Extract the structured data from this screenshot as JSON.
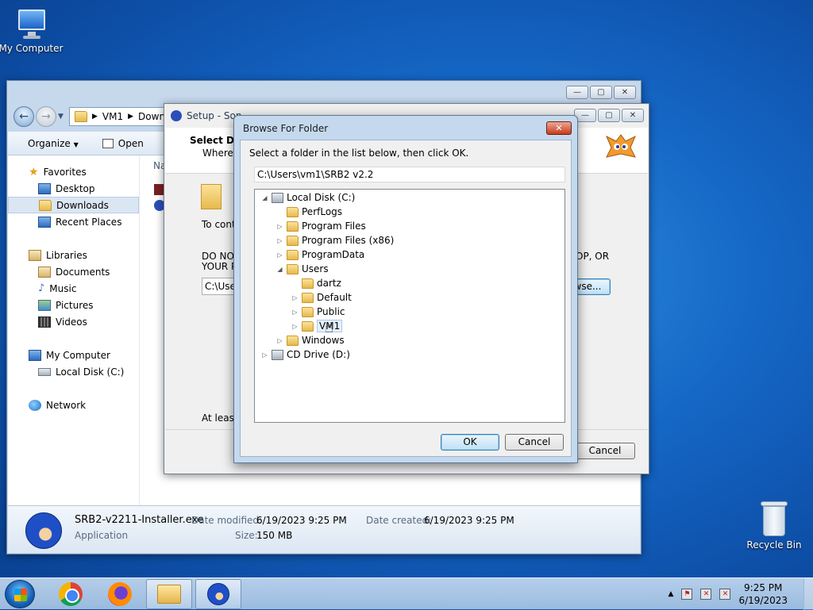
{
  "desktop": {
    "my_computer": "My Computer",
    "recycle_bin": "Recycle Bin"
  },
  "explorer": {
    "breadcrumb": [
      "VM1",
      "Down"
    ],
    "toolbar": {
      "organize": "Organize",
      "open": "Open"
    },
    "column_header": "Na",
    "nav": {
      "favorites": "Favorites",
      "desktop": "Desktop",
      "downloads": "Downloads",
      "recent": "Recent Places",
      "libraries": "Libraries",
      "documents": "Documents",
      "music": "Music",
      "pictures": "Pictures",
      "videos": "Videos",
      "my_computer": "My Computer",
      "local_disk": "Local Disk (C:)",
      "network": "Network"
    },
    "details": {
      "filename": "SRB2-v2211-Installer.exe",
      "type": "Application",
      "modified_label": "Date modified:",
      "modified_value": "6/19/2023 9:25 PM",
      "created_label": "Date created:",
      "created_value": "6/19/2023 9:25 PM",
      "size_label": "Size:",
      "size_value": "150 MB"
    }
  },
  "setup": {
    "title": "Setup - Son",
    "heading": "Select Des",
    "subheading": "Where s",
    "to_continue": "To contin",
    "warning_line1": "DO NOT",
    "warning_line2": "YOUR PF",
    "warning_right": "OP, OR",
    "path_value": "C:\\User",
    "browse_button": "wse...",
    "at_least": "At least",
    "cancel_button": "Cancel"
  },
  "browse_dialog": {
    "title": "Browse For Folder",
    "instruction": "Select a folder in the list below, then click OK.",
    "path": "C:\\Users\\vm1\\SRB2 v2.2",
    "tree": [
      {
        "label": "Local Disk (C:)",
        "toggle": "◢",
        "icon": "disk"
      },
      {
        "label": "PerfLogs",
        "toggle": "",
        "icon": "folder"
      },
      {
        "label": "Program Files",
        "toggle": "▷",
        "icon": "folder"
      },
      {
        "label": "Program Files (x86)",
        "toggle": "▷",
        "icon": "folder"
      },
      {
        "label": "ProgramData",
        "toggle": "▷",
        "icon": "folder"
      },
      {
        "label": "Users",
        "toggle": "◢",
        "icon": "folder"
      },
      {
        "label": "dartz",
        "toggle": "",
        "icon": "folder"
      },
      {
        "label": "Default",
        "toggle": "▷",
        "icon": "folder"
      },
      {
        "label": "Public",
        "toggle": "▷",
        "icon": "folder"
      },
      {
        "label": "VM1",
        "toggle": "▷",
        "icon": "user-folder"
      },
      {
        "label": "Windows",
        "toggle": "▷",
        "icon": "folder"
      },
      {
        "label": "CD Drive (D:)",
        "toggle": "▷",
        "icon": "cd-drive"
      }
    ],
    "ok_button": "OK",
    "cancel_button": "Cancel"
  },
  "taskbar": {
    "time": "9:25 PM",
    "date": "6/19/2023"
  }
}
